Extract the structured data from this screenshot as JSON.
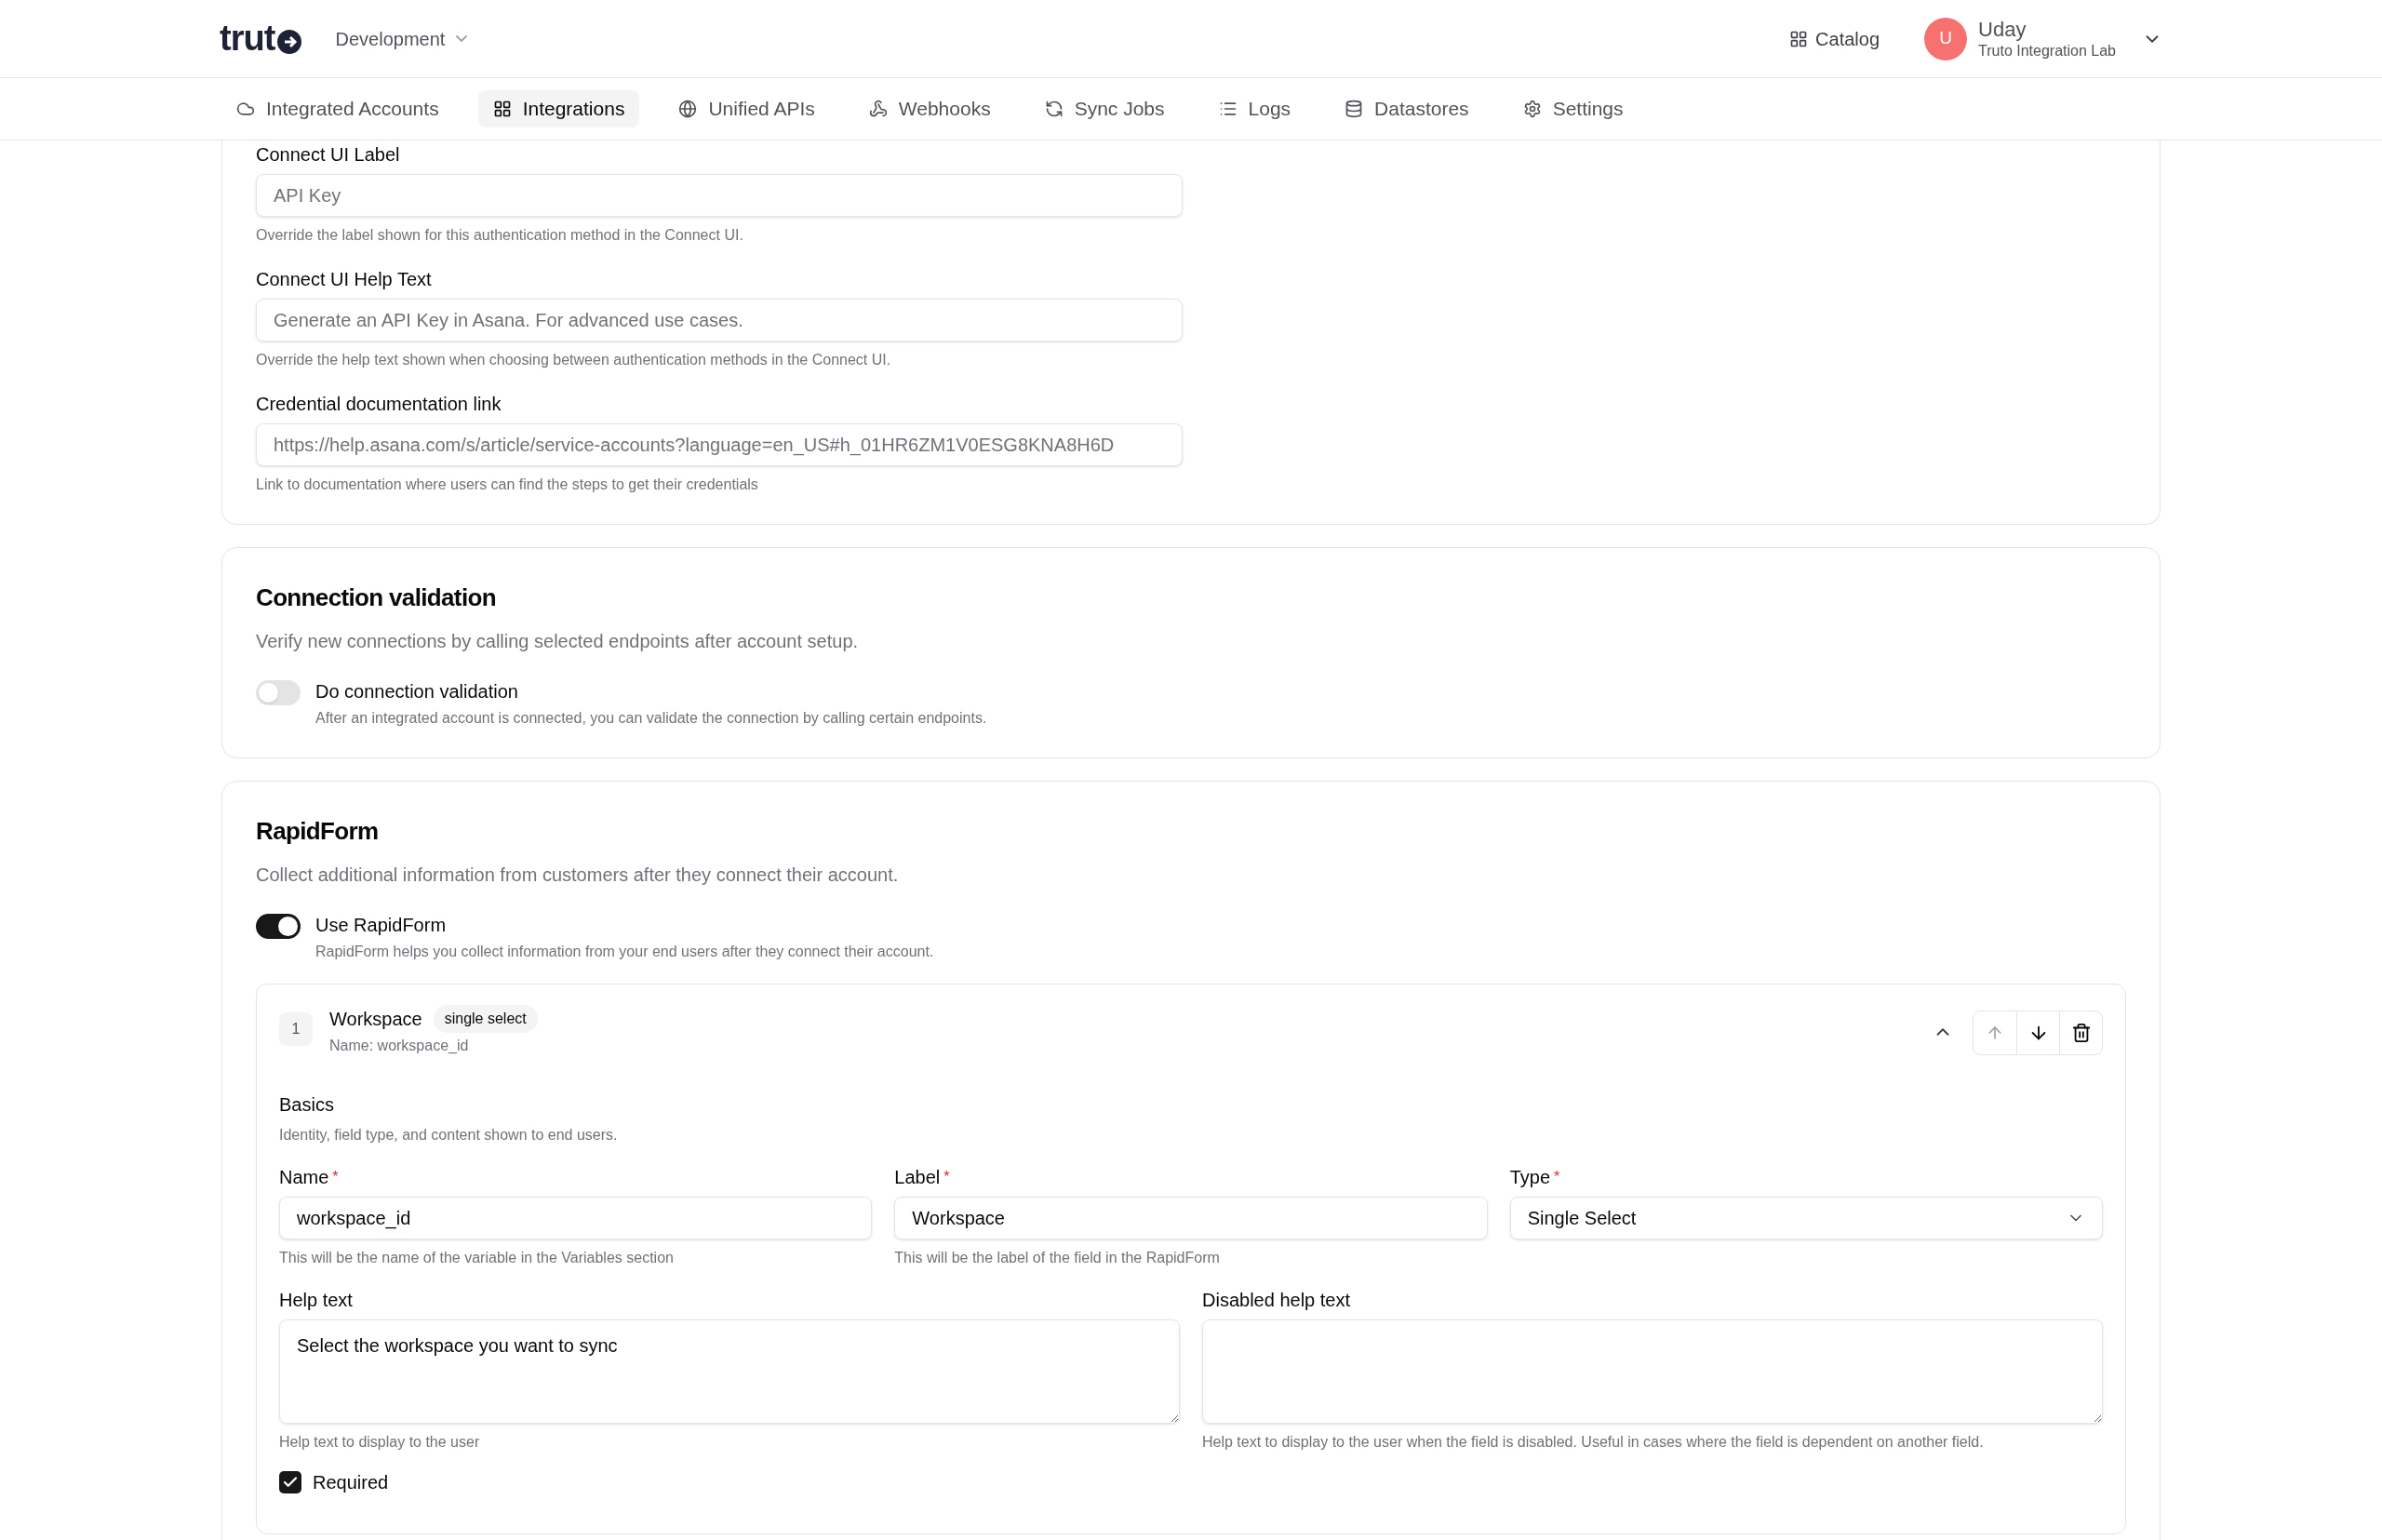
{
  "header": {
    "logo": "trut",
    "environment": "Development",
    "catalog": "Catalog",
    "user": {
      "initial": "U",
      "name": "Uday",
      "org": "Truto Integration Lab"
    }
  },
  "nav": [
    {
      "label": "Integrated Accounts",
      "selected": false
    },
    {
      "label": "Integrations",
      "selected": true
    },
    {
      "label": "Unified APIs",
      "selected": false
    },
    {
      "label": "Webhooks",
      "selected": false
    },
    {
      "label": "Sync Jobs",
      "selected": false
    },
    {
      "label": "Logs",
      "selected": false
    },
    {
      "label": "Datastores",
      "selected": false
    },
    {
      "label": "Settings",
      "selected": false
    }
  ],
  "auth_fields": [
    {
      "label": "Connect UI Label",
      "placeholder": "API Key",
      "hint": "Override the label shown for this authentication method in the Connect UI."
    },
    {
      "label": "Connect UI Help Text",
      "placeholder": "Generate an API Key in Asana. For advanced use cases.",
      "hint": "Override the help text shown when choosing between authentication methods in the Connect UI."
    },
    {
      "label": "Credential documentation link",
      "placeholder": "https://help.asana.com/s/article/service-accounts?language=en_US#h_01HR6ZM1V0ESG8KNA8H6D",
      "hint": "Link to documentation where users can find the steps to get their credentials"
    }
  ],
  "connection_validation": {
    "title": "Connection validation",
    "description": "Verify new connections by calling selected endpoints after account setup.",
    "toggle": {
      "label": "Do connection validation",
      "hint": "After an integrated account is connected, you can validate the connection by calling certain endpoints.",
      "on": false
    }
  },
  "rapidform": {
    "title": "RapidForm",
    "description": "Collect additional information from customers after they connect their account.",
    "toggle": {
      "label": "Use RapidForm",
      "hint": "RapidForm helps you collect information from your end users after they connect their account.",
      "on": true
    },
    "field": {
      "index": "1",
      "title": "Workspace",
      "type_badge": "single select",
      "name_line": "Name: workspace_id",
      "expanded": true,
      "section": {
        "title": "Basics",
        "description": "Identity, field type, and content shown to end users."
      },
      "inputs": [
        {
          "kind": "text",
          "label": "Name",
          "required_mark": "*",
          "value": "workspace_id",
          "hint": "This will be the name of the variable in the Variables section"
        },
        {
          "kind": "text",
          "label": "Label",
          "required_mark": "*",
          "value": "Workspace",
          "hint": "This will be the label of the field in the RapidForm"
        },
        {
          "kind": "select",
          "label": "Type",
          "required_mark": "*",
          "value": "Single Select"
        }
      ],
      "textareas": [
        {
          "label": "Help text",
          "value": "Select the workspace you want to sync",
          "hint": "Help text to display to the user"
        },
        {
          "label": "Disabled help text",
          "hint": "Help text to display to the user when the field is disabled. Useful in cases where the field is dependent on another field."
        }
      ],
      "required_checkbox": {
        "label": "Required",
        "checked": true
      }
    }
  }
}
